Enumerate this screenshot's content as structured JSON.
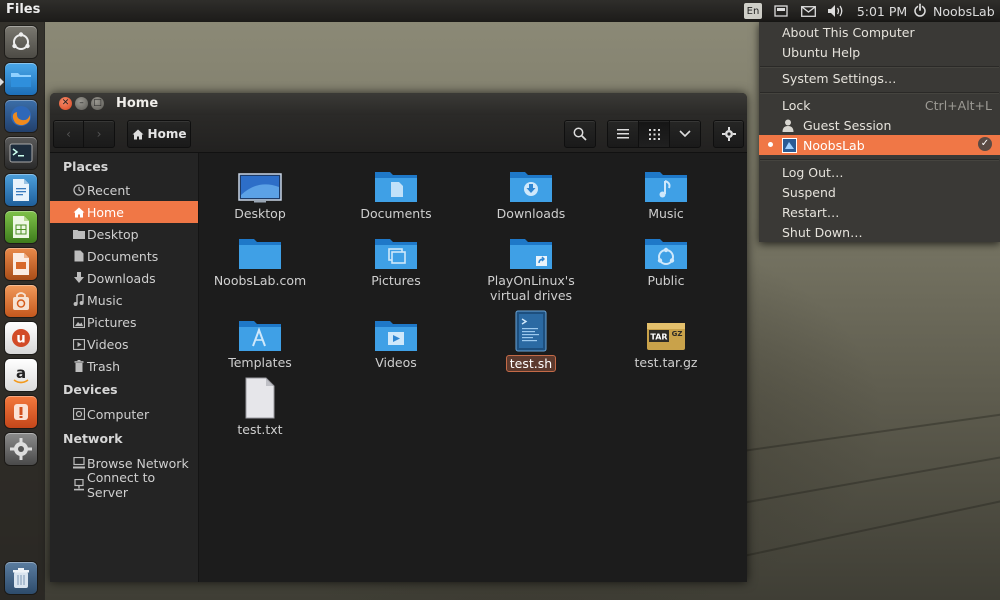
{
  "topbar": {
    "app_title": "Files",
    "keyboard_indicator": "En",
    "clock": "5:01 PM",
    "user_name": "NoobsLab"
  },
  "launcher": {
    "items": [
      {
        "name": "dash-home"
      },
      {
        "name": "files"
      },
      {
        "name": "firefox"
      },
      {
        "name": "terminal"
      },
      {
        "name": "libreoffice-writer"
      },
      {
        "name": "libreoffice-calc"
      },
      {
        "name": "libreoffice-impress"
      },
      {
        "name": "ubuntu-software-center"
      },
      {
        "name": "ubuntu-one"
      },
      {
        "name": "amazon"
      },
      {
        "name": "update-manager"
      },
      {
        "name": "system-settings"
      },
      {
        "name": "trash"
      }
    ]
  },
  "window": {
    "title": "Home",
    "breadcrumb_label": "Home"
  },
  "sidebar": {
    "places_header": "Places",
    "devices_header": "Devices",
    "network_header": "Network",
    "places": [
      {
        "label": "Recent",
        "icon": "clock-icon"
      },
      {
        "label": "Home",
        "icon": "home-icon",
        "active": true
      },
      {
        "label": "Desktop",
        "icon": "desktop-folder-icon"
      },
      {
        "label": "Documents",
        "icon": "document-icon"
      },
      {
        "label": "Downloads",
        "icon": "download-icon"
      },
      {
        "label": "Music",
        "icon": "music-note-icon"
      },
      {
        "label": "Pictures",
        "icon": "picture-icon"
      },
      {
        "label": "Videos",
        "icon": "video-icon"
      },
      {
        "label": "Trash",
        "icon": "trash-icon"
      }
    ],
    "devices": [
      {
        "label": "Computer",
        "icon": "computer-icon"
      }
    ],
    "network": [
      {
        "label": "Browse Network",
        "icon": "network-icon"
      },
      {
        "label": "Connect to Server",
        "icon": "server-icon"
      }
    ]
  },
  "files": [
    {
      "label": "Desktop",
      "icon": "desktop-folder-icon"
    },
    {
      "label": "Documents",
      "icon": "documents-folder-icon"
    },
    {
      "label": "Downloads",
      "icon": "downloads-folder-icon"
    },
    {
      "label": "Music",
      "icon": "music-folder-icon"
    },
    {
      "label": "NoobsLab.com",
      "icon": "folder-icon"
    },
    {
      "label": "Pictures",
      "icon": "pictures-folder-icon"
    },
    {
      "label": "PlayOnLinux's virtual drives",
      "icon": "link-folder-icon"
    },
    {
      "label": "Public",
      "icon": "public-folder-icon"
    },
    {
      "label": "Templates",
      "icon": "templates-folder-icon"
    },
    {
      "label": "Videos",
      "icon": "videos-folder-icon"
    },
    {
      "label": "test.sh",
      "icon": "shell-script-icon",
      "selected": true
    },
    {
      "label": "test.tar.gz",
      "icon": "tar-archive-icon"
    },
    {
      "label": "test.txt",
      "icon": "text-file-icon"
    }
  ],
  "session_menu": {
    "about": "About This Computer",
    "help": "Ubuntu Help",
    "settings": "System Settings…",
    "lock": "Lock",
    "lock_shortcut": "Ctrl+Alt+L",
    "guest": "Guest Session",
    "user": "NoobsLab",
    "logout": "Log Out…",
    "suspend": "Suspend",
    "restart": "Restart…",
    "shutdown": "Shut Down…"
  },
  "colors": {
    "accent": "#f07746",
    "folder_blue": "#3fa0e6"
  }
}
